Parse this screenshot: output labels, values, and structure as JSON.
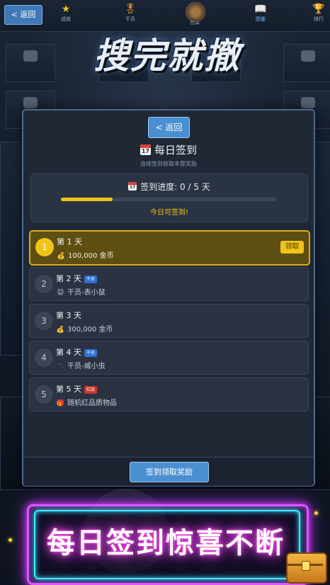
{
  "nav": {
    "back_label": "< 返回",
    "tabs": [
      {
        "label": "成就",
        "icon": "star-icon"
      },
      {
        "label": "干员",
        "icon": "medal-icon"
      },
      {
        "label": "仓库",
        "icon": "box-icon"
      },
      {
        "label": "图鉴",
        "icon": "book-icon"
      },
      {
        "label": "排行",
        "icon": "trophy-icon"
      }
    ]
  },
  "game_logo": "搜完就撤",
  "modal": {
    "back_label": "< 返回",
    "title": "每日签到",
    "subtitle": "连续签到获取丰厚奖励",
    "calendar_icon_text": "17",
    "progress": {
      "label": "签到进度: 0 / 5 天",
      "signed_days": 0,
      "total_days": 5,
      "fill_fraction": 0.24,
      "status": "今日可签到!"
    },
    "days": [
      {
        "day": "1",
        "title": "第 1 天",
        "tag": "",
        "reward": "100,000 金币",
        "icon": "💰",
        "claim": "领取",
        "active": true
      },
      {
        "day": "2",
        "title": "第 2 天",
        "tag": "干员",
        "reward": "干员-表小鼠",
        "icon": "🐭",
        "claim": "",
        "active": false
      },
      {
        "day": "3",
        "title": "第 3 天",
        "tag": "",
        "reward": "300,000 金币",
        "icon": "💰",
        "claim": "",
        "active": false
      },
      {
        "day": "4",
        "title": "第 4 天",
        "tag": "干员",
        "reward": "干员-威小虫",
        "icon": "〽",
        "claim": "",
        "active": false
      },
      {
        "day": "5",
        "title": "第 5 天",
        "tag": "红品",
        "reward": "随机红品质物品",
        "icon": "🎁",
        "claim": "",
        "active": false
      }
    ],
    "signin_button": "签到领取奖励"
  },
  "banner_text": "每日签到惊喜不断",
  "colors": {
    "accent_gold": "#f0c419",
    "button_blue": "#4a8fd0",
    "tag_blue": "#2d6fd2",
    "tag_red": "#c5372f",
    "neon_pink": "#e253ff",
    "neon_cyan": "#45e6ff"
  }
}
